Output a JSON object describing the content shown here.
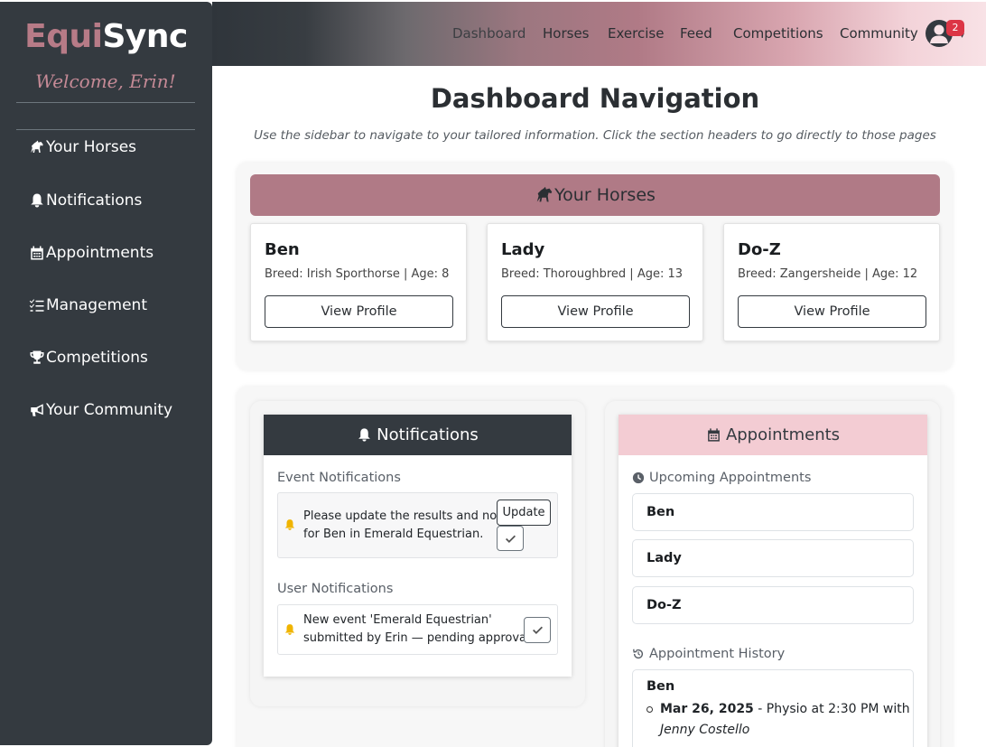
{
  "brand": {
    "part1": "Equi",
    "part2": "Sync"
  },
  "sidebar": {
    "welcome": "Welcome, Erin!",
    "items": [
      {
        "label": "Your Horses",
        "icon": "horse-icon"
      },
      {
        "label": "Notifications",
        "icon": "bell-icon"
      },
      {
        "label": "Appointments",
        "icon": "calendar-icon"
      },
      {
        "label": "Management",
        "icon": "list-check-icon"
      },
      {
        "label": "Competitions",
        "icon": "trophy-icon"
      },
      {
        "label": "Your Community",
        "icon": "megaphone-icon"
      }
    ]
  },
  "topnav": {
    "links": [
      "Dashboard",
      "Horses",
      "Exercise",
      "Feed",
      "Competitions",
      "Community"
    ],
    "badge_count": "2",
    "caret": "▾"
  },
  "main": {
    "title": "Dashboard Navigation",
    "subtitle": "Use the sidebar to navigate to your tailored information. Click the section headers to go directly to those pages"
  },
  "horses": {
    "header": "Your Horses",
    "cards": [
      {
        "name": "Ben",
        "info": "Breed: Irish Sporthorse | Age: 8",
        "button": "View Profile"
      },
      {
        "name": "Lady",
        "info": "Breed: Thoroughbred | Age: 13",
        "button": "View Profile"
      },
      {
        "name": "Do-Z",
        "info": "Breed: Zangersheide | Age: 12",
        "button": "View Profile"
      }
    ]
  },
  "notifications": {
    "header": "Notifications",
    "event_label": "Event Notifications",
    "event_line1": "Please update the results and notes",
    "event_line2": "for Ben in Emerald Equestrian.",
    "update_button": "Update",
    "user_label": "User Notifications",
    "user_line1": "New event 'Emerald Equestrian'",
    "user_line2": "submitted by Erin — pending approval."
  },
  "appointments": {
    "header": "Appointments",
    "upcoming_label": "Upcoming Appointments",
    "upcoming": [
      "Ben",
      "Lady",
      "Do-Z"
    ],
    "history_label": "Appointment History",
    "history_horse": "Ben",
    "history_date": "Mar 26, 2025",
    "history_text": " - Physio at 2:30 PM with",
    "history_person": "Jenny Costello"
  },
  "colors": {
    "sidebar_bg": "#343a40",
    "accent_rose": "#b07a86",
    "pink_header": "#f3ccd3",
    "badge_red": "#dc3545",
    "bell_yellow": "#f0b400"
  }
}
